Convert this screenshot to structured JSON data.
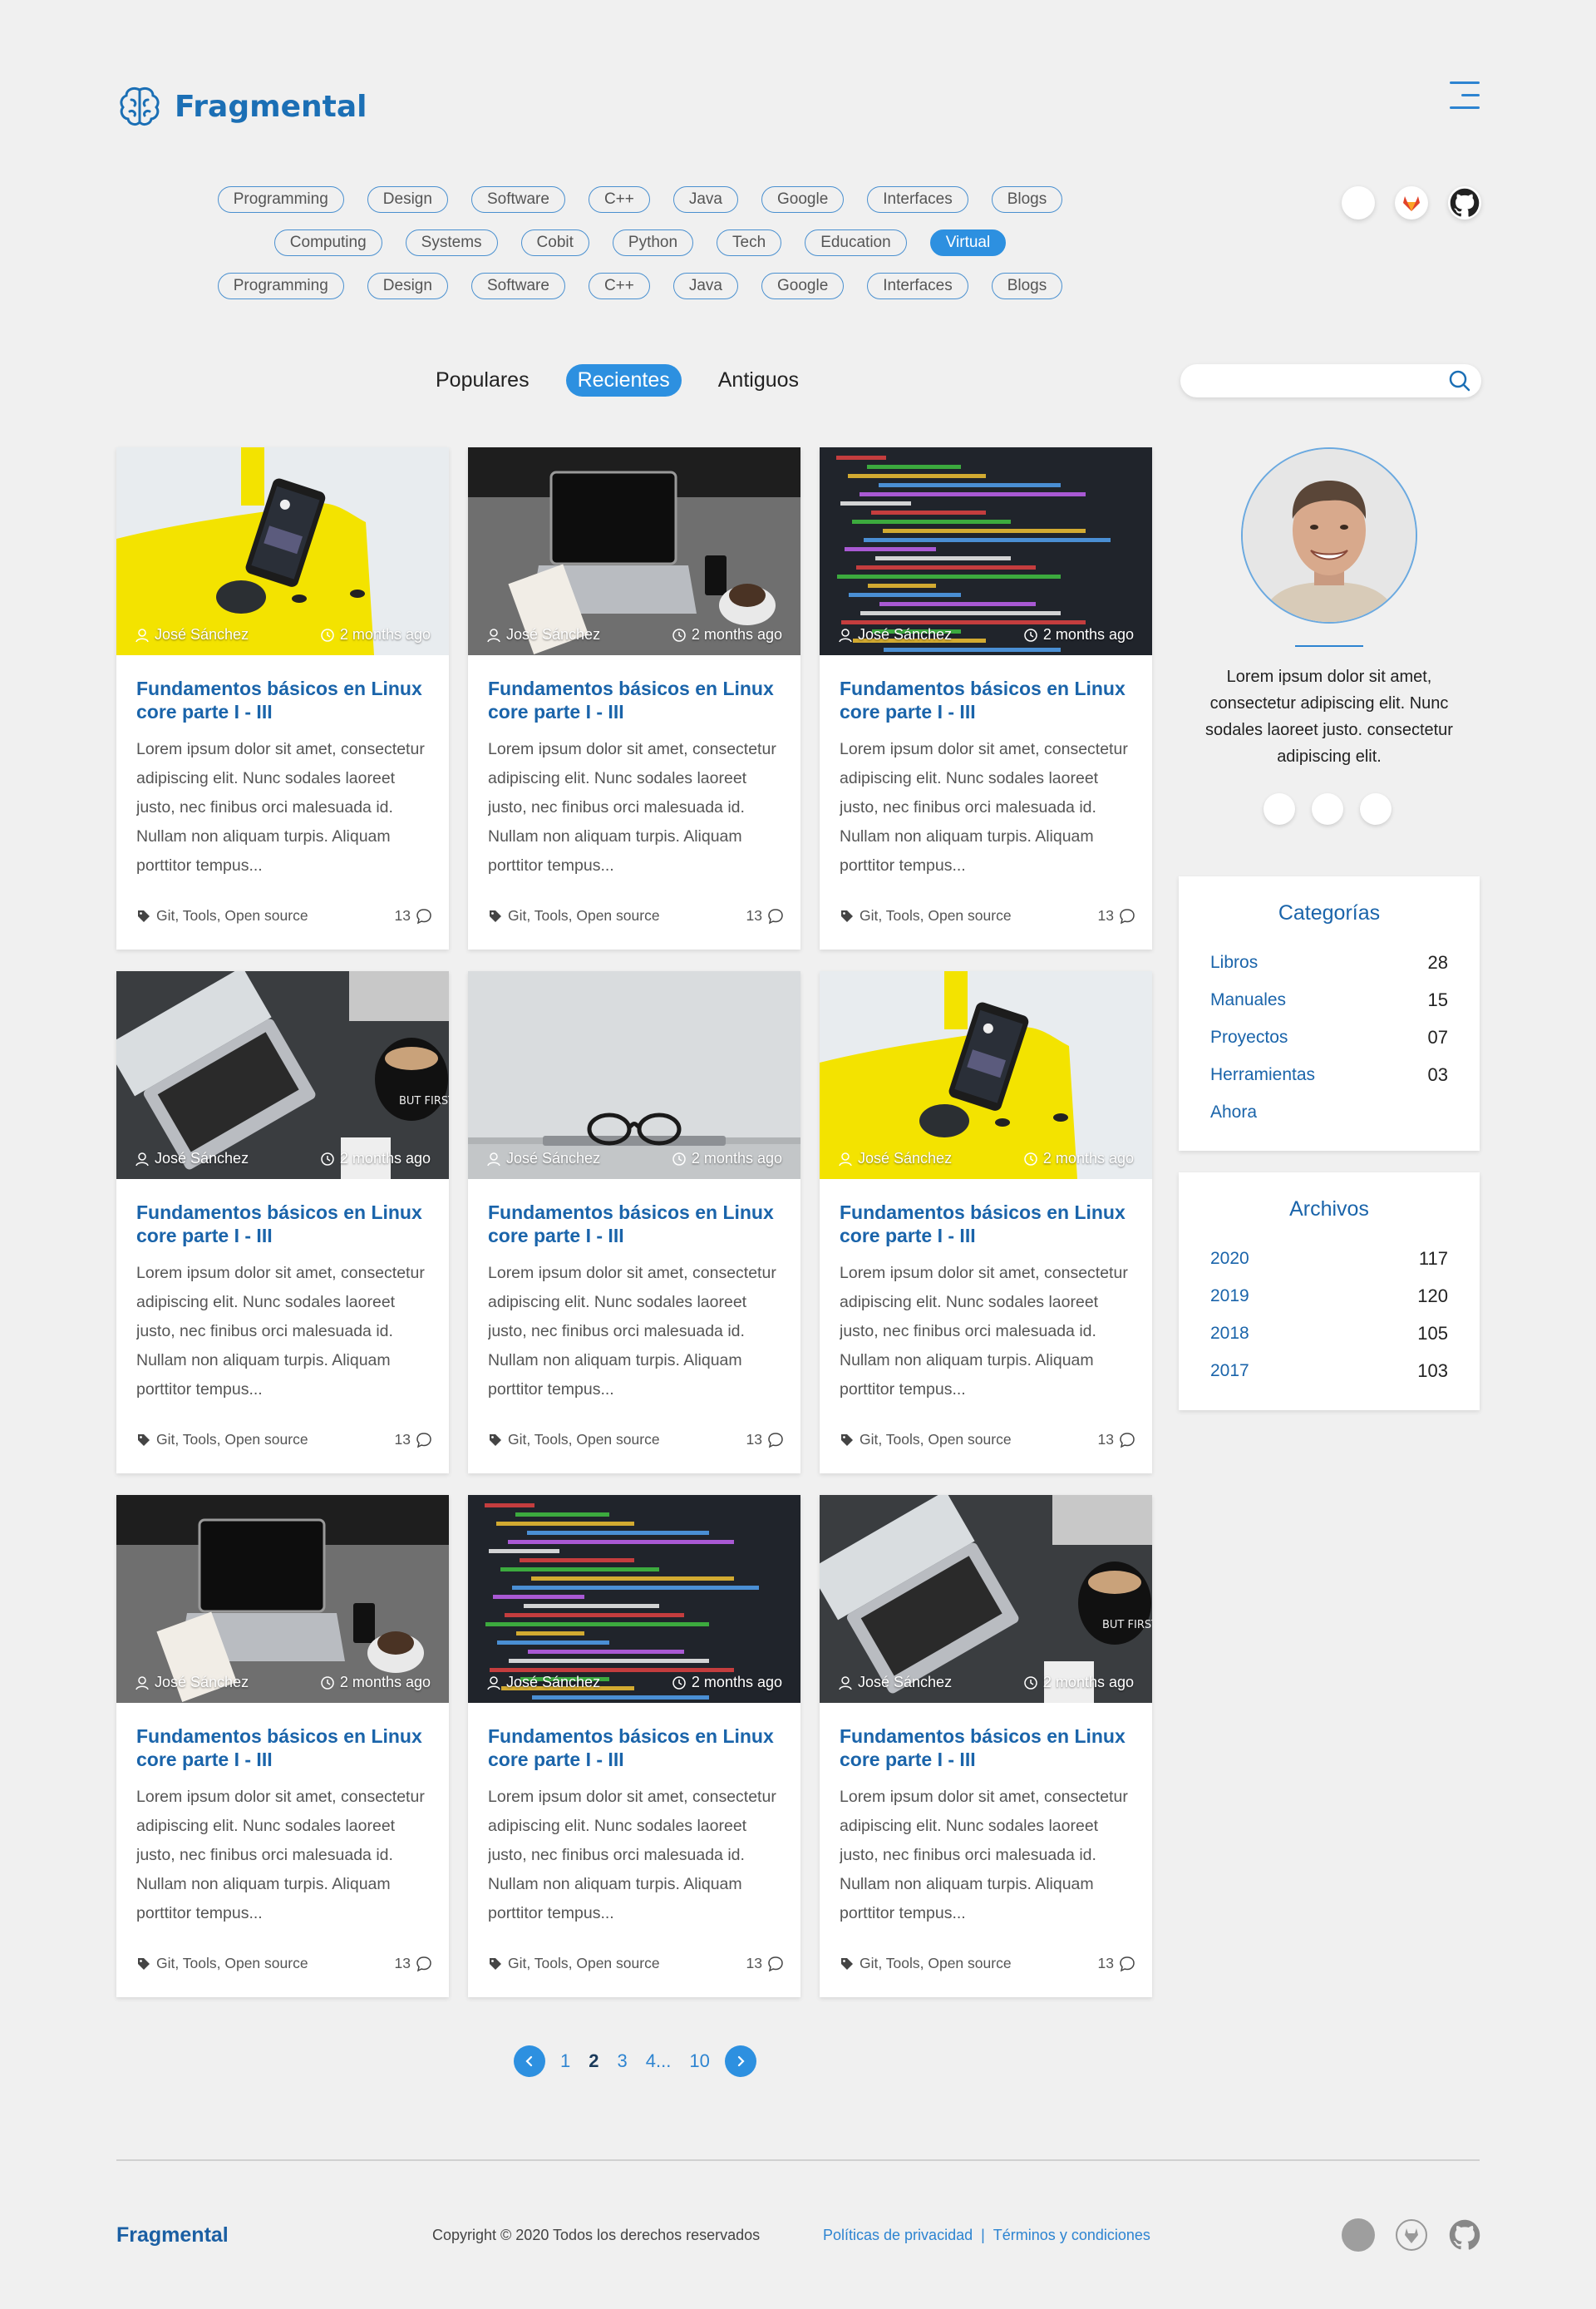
{
  "brand": {
    "name": "Fragmental"
  },
  "tags": {
    "row1": [
      "Programming",
      "Design",
      "Software",
      "C++",
      "Java",
      "Google",
      "Interfaces",
      "Blogs"
    ],
    "row2": [
      "Computing",
      "Systems",
      "Cobit",
      "Python",
      "Tech",
      "Education",
      "Virtual"
    ],
    "row3": [
      "Programming",
      "Design",
      "Software",
      "C++",
      "Java",
      "Google",
      "Interfaces",
      "Blogs"
    ],
    "active": "Virtual"
  },
  "social": {
    "icons": [
      "blank-icon",
      "gitlab-icon",
      "github-icon"
    ]
  },
  "sort": {
    "tabs": [
      "Populares",
      "Recientes",
      "Antiguos"
    ],
    "active": "Recientes"
  },
  "search": {
    "placeholder": ""
  },
  "posts": [
    {
      "image": "yellow-phone",
      "author": "José Sánchez",
      "time": "2 months ago",
      "title": "Fundamentos básicos en Linux core parte I - III",
      "excerpt": "Lorem ipsum dolor sit amet, consectetur adipiscing elit. Nunc sodales laoreet justo, nec finibus orci malesuada id. Nullam non aliquam turpis. Aliquam porttitor tempus...",
      "tags": "Git, Tools, Open source",
      "comments": "13"
    },
    {
      "image": "laptop-desk",
      "author": "José Sánchez",
      "time": "2 months ago",
      "title": "Fundamentos básicos en Linux core parte I - III",
      "excerpt": "Lorem ipsum dolor sit amet, consectetur adipiscing elit. Nunc sodales laoreet justo, nec finibus orci malesuada id. Nullam non aliquam turpis. Aliquam porttitor tempus...",
      "tags": "Git, Tools, Open source",
      "comments": "13"
    },
    {
      "image": "code-screen",
      "author": "José Sánchez",
      "time": "2 months ago",
      "title": "Fundamentos básicos en Linux core parte I - III",
      "excerpt": "Lorem ipsum dolor sit amet, consectetur adipiscing elit. Nunc sodales laoreet justo, nec finibus orci malesuada id. Nullam non aliquam turpis. Aliquam porttitor tempus...",
      "tags": "Git, Tools, Open source",
      "comments": "13"
    },
    {
      "image": "laptop-coffee",
      "author": "José Sánchez",
      "time": "2 months ago",
      "title": "Fundamentos básicos en Linux core parte I - III",
      "excerpt": "Lorem ipsum dolor sit amet, consectetur adipiscing elit. Nunc sodales laoreet justo, nec finibus orci malesuada id. Nullam non aliquam turpis. Aliquam porttitor tempus...",
      "tags": "Git, Tools, Open source",
      "comments": "13"
    },
    {
      "image": "glasses",
      "author": "José Sánchez",
      "time": "2 months ago",
      "title": "Fundamentos básicos en Linux core parte I - III",
      "excerpt": "Lorem ipsum dolor sit amet, consectetur adipiscing elit. Nunc sodales laoreet justo, nec finibus orci malesuada id. Nullam non aliquam turpis. Aliquam porttitor tempus...",
      "tags": "Git, Tools, Open source",
      "comments": "13"
    },
    {
      "image": "yellow-phone",
      "author": "José Sánchez",
      "time": "2 months ago",
      "title": "Fundamentos básicos en Linux core parte I - III",
      "excerpt": "Lorem ipsum dolor sit amet, consectetur adipiscing elit. Nunc sodales laoreet justo, nec finibus orci malesuada id. Nullam non aliquam turpis. Aliquam porttitor tempus...",
      "tags": "Git, Tools, Open source",
      "comments": "13"
    },
    {
      "image": "laptop-desk",
      "author": "José Sánchez",
      "time": "2 months ago",
      "title": "Fundamentos básicos en Linux core parte I - III",
      "excerpt": "Lorem ipsum dolor sit amet, consectetur adipiscing elit. Nunc sodales laoreet justo, nec finibus orci malesuada id. Nullam non aliquam turpis. Aliquam porttitor tempus...",
      "tags": "Git, Tools, Open source",
      "comments": "13"
    },
    {
      "image": "code-screen",
      "author": "José Sánchez",
      "time": "2 months ago",
      "title": "Fundamentos básicos en Linux core parte I - III",
      "excerpt": "Lorem ipsum dolor sit amet, consectetur adipiscing elit. Nunc sodales laoreet justo, nec finibus orci malesuada id. Nullam non aliquam turpis. Aliquam porttitor tempus...",
      "tags": "Git, Tools, Open source",
      "comments": "13"
    },
    {
      "image": "laptop-coffee",
      "author": "José Sánchez",
      "time": "2 months ago",
      "title": "Fundamentos básicos en Linux core parte I - III",
      "excerpt": "Lorem ipsum dolor sit amet, consectetur adipiscing elit. Nunc sodales laoreet justo, nec finibus orci malesuada id. Nullam non aliquam turpis. Aliquam porttitor tempus...",
      "tags": "Git, Tools, Open source",
      "comments": "13"
    }
  ],
  "pagination": {
    "pages": [
      "1",
      "2",
      "3",
      "4...",
      "10"
    ],
    "current": "2"
  },
  "profile": {
    "bio": "Lorem ipsum dolor sit amet, consectetur adipiscing elit. Nunc sodales laoreet justo. consectetur adipiscing elit."
  },
  "categories": {
    "title": "Categorías",
    "items": [
      {
        "label": "Libros",
        "count": "28"
      },
      {
        "label": "Manuales",
        "count": "15"
      },
      {
        "label": "Proyectos",
        "count": "07"
      },
      {
        "label": "Herramientas",
        "count": "03"
      },
      {
        "label": "Ahora",
        "count": ""
      }
    ]
  },
  "archives": {
    "title": "Archivos",
    "items": [
      {
        "label": "2020",
        "count": "117"
      },
      {
        "label": "2019",
        "count": "120"
      },
      {
        "label": "2018",
        "count": "105"
      },
      {
        "label": "2017",
        "count": "103"
      }
    ]
  },
  "footer": {
    "brand": "Fragmental",
    "copyright": "Copyright © 2020 Todos los derechos reservados",
    "privacy": "Políticas de privacidad",
    "separator": "|",
    "terms": "Términos y condiciones"
  },
  "colors": {
    "accent": "#2d90e0",
    "title": "#1a64aa",
    "brand": "#1b6fb5",
    "background": "#f0f0f0"
  }
}
